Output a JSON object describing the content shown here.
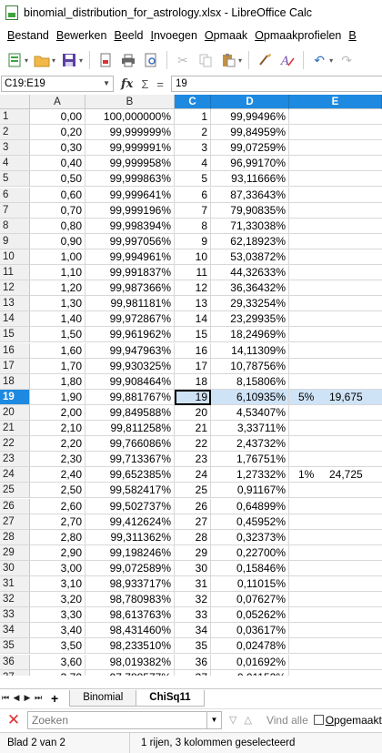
{
  "window": {
    "title": "binomial_distribution_for_astrology.xlsx - LibreOffice Calc"
  },
  "menu": [
    "Bestand",
    "Bewerken",
    "Beeld",
    "Invoegen",
    "Opmaak",
    "Opmaakprofielen",
    "B"
  ],
  "toolbar": [
    "new-icon",
    "open-icon",
    "save-icon",
    "export-pdf-icon",
    "print-icon",
    "print-preview-icon",
    "cut-icon",
    "copy-icon",
    "paste-icon",
    "clone-formatting-icon",
    "clear-formatting-icon",
    "undo-icon",
    "redo-icon"
  ],
  "formula_bar": {
    "name_box": "C19:E19",
    "fx": "fx",
    "sum": "Σ",
    "equals": "=",
    "content": "19"
  },
  "columns": [
    "A",
    "B",
    "C",
    "D",
    "E"
  ],
  "selected_columns": [
    "C",
    "D",
    "E"
  ],
  "selected_row": 19,
  "rows": [
    {
      "n": "1",
      "a": "0,00",
      "b": "100,000000%",
      "c": "1",
      "d": "99,99496%",
      "e1": "",
      "e2": ""
    },
    {
      "n": "2",
      "a": "0,20",
      "b": "99,999999%",
      "c": "2",
      "d": "99,84959%",
      "e1": "",
      "e2": ""
    },
    {
      "n": "3",
      "a": "0,30",
      "b": "99,999991%",
      "c": "3",
      "d": "99,07259%",
      "e1": "",
      "e2": ""
    },
    {
      "n": "4",
      "a": "0,40",
      "b": "99,999958%",
      "c": "4",
      "d": "96,99170%",
      "e1": "",
      "e2": ""
    },
    {
      "n": "5",
      "a": "0,50",
      "b": "99,999863%",
      "c": "5",
      "d": "93,11666%",
      "e1": "",
      "e2": ""
    },
    {
      "n": "6",
      "a": "0,60",
      "b": "99,999641%",
      "c": "6",
      "d": "87,33643%",
      "e1": "",
      "e2": ""
    },
    {
      "n": "7",
      "a": "0,70",
      "b": "99,999196%",
      "c": "7",
      "d": "79,90835%",
      "e1": "",
      "e2": ""
    },
    {
      "n": "8",
      "a": "0,80",
      "b": "99,998394%",
      "c": "8",
      "d": "71,33038%",
      "e1": "",
      "e2": ""
    },
    {
      "n": "9",
      "a": "0,90",
      "b": "99,997056%",
      "c": "9",
      "d": "62,18923%",
      "e1": "",
      "e2": ""
    },
    {
      "n": "10",
      "a": "1,00",
      "b": "99,994961%",
      "c": "10",
      "d": "53,03872%",
      "e1": "",
      "e2": ""
    },
    {
      "n": "11",
      "a": "1,10",
      "b": "99,991837%",
      "c": "11",
      "d": "44,32633%",
      "e1": "",
      "e2": ""
    },
    {
      "n": "12",
      "a": "1,20",
      "b": "99,987366%",
      "c": "12",
      "d": "36,36432%",
      "e1": "",
      "e2": ""
    },
    {
      "n": "13",
      "a": "1,30",
      "b": "99,981181%",
      "c": "13",
      "d": "29,33254%",
      "e1": "",
      "e2": ""
    },
    {
      "n": "14",
      "a": "1,40",
      "b": "99,972867%",
      "c": "14",
      "d": "23,29935%",
      "e1": "",
      "e2": ""
    },
    {
      "n": "15",
      "a": "1,50",
      "b": "99,961962%",
      "c": "15",
      "d": "18,24969%",
      "e1": "",
      "e2": ""
    },
    {
      "n": "16",
      "a": "1,60",
      "b": "99,947963%",
      "c": "16",
      "d": "14,11309%",
      "e1": "",
      "e2": ""
    },
    {
      "n": "17",
      "a": "1,70",
      "b": "99,930325%",
      "c": "17",
      "d": "10,78756%",
      "e1": "",
      "e2": ""
    },
    {
      "n": "18",
      "a": "1,80",
      "b": "99,908464%",
      "c": "18",
      "d": "8,15806%",
      "e1": "",
      "e2": ""
    },
    {
      "n": "19",
      "a": "1,90",
      "b": "99,881767%",
      "c": "19",
      "d": "6,10935%",
      "e1": "5%",
      "e2": "19,675"
    },
    {
      "n": "20",
      "a": "2,00",
      "b": "99,849588%",
      "c": "20",
      "d": "4,53407%",
      "e1": "",
      "e2": ""
    },
    {
      "n": "21",
      "a": "2,10",
      "b": "99,811258%",
      "c": "21",
      "d": "3,33711%",
      "e1": "",
      "e2": ""
    },
    {
      "n": "22",
      "a": "2,20",
      "b": "99,766086%",
      "c": "22",
      "d": "2,43732%",
      "e1": "",
      "e2": ""
    },
    {
      "n": "23",
      "a": "2,30",
      "b": "99,713367%",
      "c": "23",
      "d": "1,76751%",
      "e1": "",
      "e2": ""
    },
    {
      "n": "24",
      "a": "2,40",
      "b": "99,652385%",
      "c": "24",
      "d": "1,27332%",
      "e1": "1%",
      "e2": "24,725"
    },
    {
      "n": "25",
      "a": "2,50",
      "b": "99,582417%",
      "c": "25",
      "d": "0,91167%",
      "e1": "",
      "e2": ""
    },
    {
      "n": "26",
      "a": "2,60",
      "b": "99,502737%",
      "c": "26",
      "d": "0,64899%",
      "e1": "",
      "e2": ""
    },
    {
      "n": "27",
      "a": "2,70",
      "b": "99,412624%",
      "c": "27",
      "d": "0,45952%",
      "e1": "",
      "e2": ""
    },
    {
      "n": "28",
      "a": "2,80",
      "b": "99,311362%",
      "c": "28",
      "d": "0,32373%",
      "e1": "",
      "e2": ""
    },
    {
      "n": "29",
      "a": "2,90",
      "b": "99,198246%",
      "c": "29",
      "d": "0,22700%",
      "e1": "",
      "e2": ""
    },
    {
      "n": "30",
      "a": "3,00",
      "b": "99,072589%",
      "c": "30",
      "d": "0,15846%",
      "e1": "",
      "e2": ""
    },
    {
      "n": "31",
      "a": "3,10",
      "b": "98,933717%",
      "c": "31",
      "d": "0,11015%",
      "e1": "",
      "e2": ""
    },
    {
      "n": "32",
      "a": "3,20",
      "b": "98,780983%",
      "c": "32",
      "d": "0,07627%",
      "e1": "",
      "e2": ""
    },
    {
      "n": "33",
      "a": "3,30",
      "b": "98,613763%",
      "c": "33",
      "d": "0,05262%",
      "e1": "",
      "e2": ""
    },
    {
      "n": "34",
      "a": "3,40",
      "b": "98,431460%",
      "c": "34",
      "d": "0,03617%",
      "e1": "",
      "e2": ""
    },
    {
      "n": "35",
      "a": "3,50",
      "b": "98,233510%",
      "c": "35",
      "d": "0,02478%",
      "e1": "",
      "e2": ""
    },
    {
      "n": "36",
      "a": "3,60",
      "b": "98,019382%",
      "c": "36",
      "d": "0,01692%",
      "e1": "",
      "e2": ""
    },
    {
      "n": "37",
      "a": "3,70",
      "b": "97,788577%",
      "c": "37",
      "d": "0,01152%",
      "e1": "",
      "e2": ""
    }
  ],
  "sheet_tabs": {
    "add": "+",
    "tabs": [
      "Binomial",
      "ChiSq11"
    ],
    "active": "ChiSq11"
  },
  "find_bar": {
    "placeholder": "Zoeken",
    "find_all": "Vind alle",
    "match_case": "Opgemaakt"
  },
  "status": {
    "sheet": "Blad 2 van 2",
    "selection": "1 rijen, 3 kolommen geselecteerd"
  },
  "colors": {
    "selection": "#1e89e0",
    "selection_fill": "#cfe3f7",
    "header_bg": "#f0f0f0"
  }
}
